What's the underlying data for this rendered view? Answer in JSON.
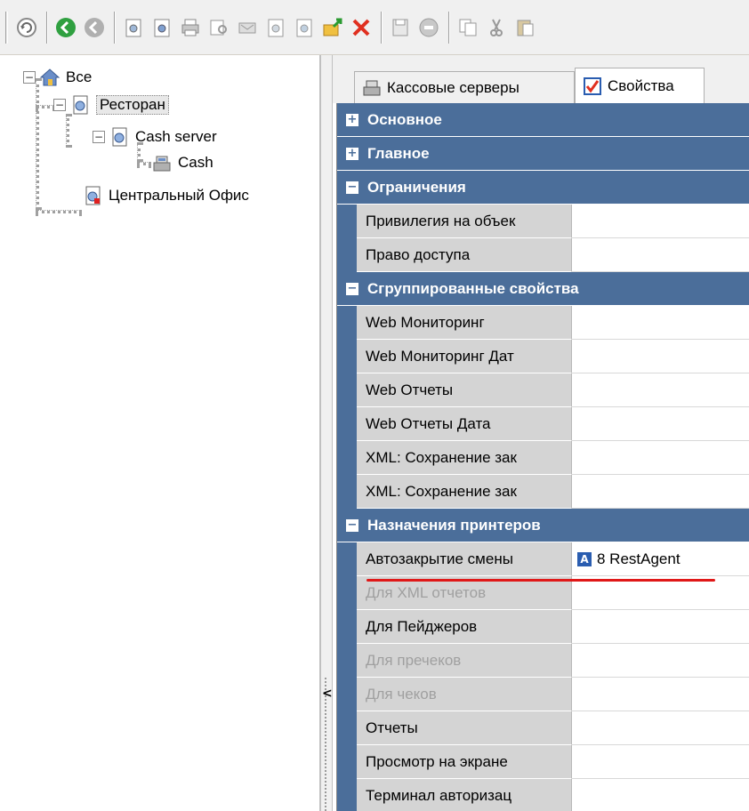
{
  "toolbar": {
    "buttons": [
      "refresh-icon",
      "back-icon",
      "forward-icon",
      "new-object-icon",
      "new-child-icon",
      "print-icon",
      "print-preview-icon",
      "export-icon",
      "object-icon",
      "object-icon-2",
      "move-up-icon",
      "delete-icon",
      "save-icon",
      "cancel-icon",
      "copy-icon",
      "cut-icon",
      "paste-icon"
    ]
  },
  "tree": {
    "root": "Все",
    "restaurant": "Ресторан",
    "cash_server": "Cash server",
    "cash": "Cash",
    "central_office": "Центральный Офис"
  },
  "tabs": {
    "cash_servers": "Кассовые серверы",
    "properties": "Свойства"
  },
  "grid": {
    "categories": {
      "basic": "Основное",
      "main": "Главное",
      "restrictions": "Ограничения",
      "grouped": "Сгруппированные свойства",
      "printers": "Назначения принтеров"
    },
    "props": {
      "privilege": "Привилегия на объек",
      "access": "Право доступа",
      "web_mon": "Web Мониторинг",
      "web_mon_date": "Web Мониторинг Дат",
      "web_reports": "Web Отчеты",
      "web_reports_date": "Web Отчеты Дата",
      "xml_save_1": "XML: Сохранение зак",
      "xml_save_2": "XML: Сохранение зак",
      "auto_close": "Автозакрытие смены",
      "auto_close_value": "8 RestAgent",
      "auto_close_icon_letter": "A",
      "xml_reports": "Для XML отчетов",
      "pagers": "Для Пейджеров",
      "prechecks": "Для пречеков",
      "checks": "Для чеков",
      "reports": "Отчеты",
      "screen_view": "Просмотр на экране",
      "terminal_auth": "Терминал авторизац"
    },
    "colors": {
      "category_bg": "#4b6e9a",
      "name_bg": "#d4d4d4",
      "highlight": "#e01818"
    }
  }
}
